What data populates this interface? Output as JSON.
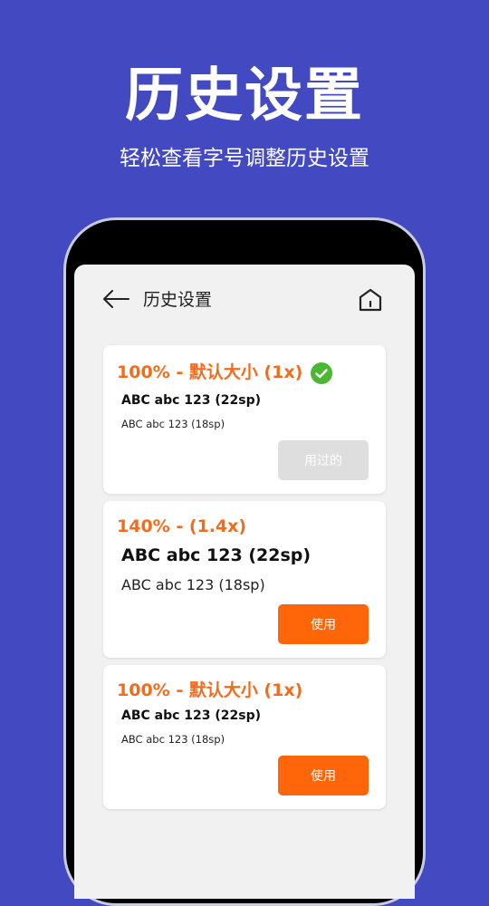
{
  "hero": {
    "title": "历史设置",
    "subtitle": "轻松查看字号调整历史设置"
  },
  "appbar": {
    "back_icon": "arrow-left-icon",
    "title": "历史设置",
    "home_icon": "home-icon"
  },
  "colors": {
    "background": "#4349c0",
    "accent": "#f36c1c",
    "button_active": "#ff6609",
    "button_disabled": "#dedede",
    "check": "#4cb733"
  },
  "cards": [
    {
      "title": "100% - 默认大小 (1x)",
      "line_large": "ABC abc 123 (22sp)",
      "line_small": "ABC abc 123 (18sp)",
      "button_label": "用过的",
      "selected_icon": "check-circle-icon"
    },
    {
      "title": "140% - (1.4x)",
      "line_large": "ABC abc 123 (22sp)",
      "line_small": "ABC abc 123 (18sp)",
      "button_label": "使用"
    },
    {
      "title": "100% - 默认大小 (1x)",
      "line_large": "ABC abc 123 (22sp)",
      "line_small": "ABC abc 123 (18sp)",
      "button_label": "使用"
    }
  ]
}
